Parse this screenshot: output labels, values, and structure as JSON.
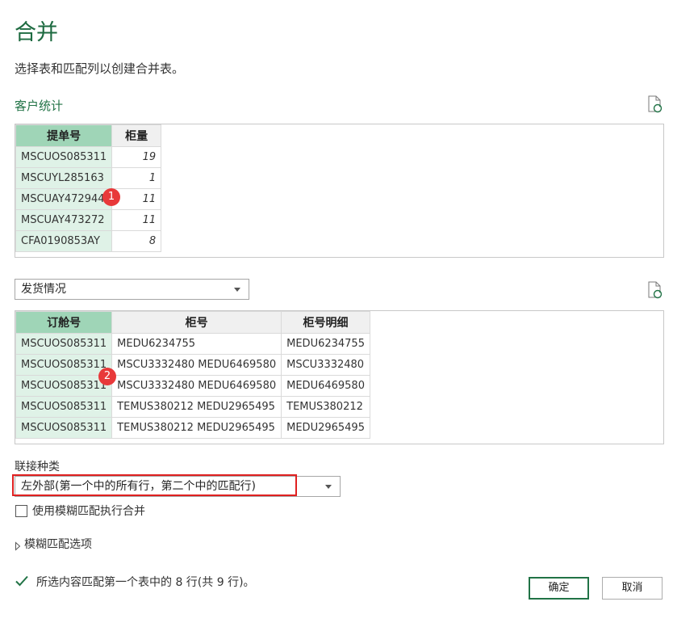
{
  "dialog": {
    "title": "合并",
    "description": "选择表和匹配列以创建合并表。"
  },
  "table1": {
    "name": "客户统计",
    "columns": [
      "提单号",
      "柜量"
    ],
    "rows": [
      [
        "MSCUOS085311",
        "19"
      ],
      [
        "MSCUYL285163",
        "1"
      ],
      [
        "MSCUAY472944",
        "11"
      ],
      [
        "MSCUAY473272",
        "11"
      ],
      [
        "CFA0190853AY",
        "8"
      ]
    ]
  },
  "table2": {
    "selected": "发货情况",
    "columns": [
      "订舱号",
      "柜号",
      "柜号明细"
    ],
    "rows": [
      [
        "MSCUOS085311",
        "MEDU6234755",
        "MEDU6234755"
      ],
      [
        "MSCUOS085311",
        "MSCU3332480 MEDU6469580",
        "MSCU3332480"
      ],
      [
        "MSCUOS085311",
        "MSCU3332480 MEDU6469580",
        "MEDU6469580"
      ],
      [
        "MSCUOS085311",
        "TEMUS380212 MEDU2965495",
        "TEMUS380212"
      ],
      [
        "MSCUOS085311",
        "TEMUS380212 MEDU2965495",
        "MEDU2965495"
      ]
    ]
  },
  "markers": [
    "1",
    "2"
  ],
  "join": {
    "label": "联接种类",
    "selected": "左外部(第一个中的所有行，第二个中的匹配行)"
  },
  "fuzzy": {
    "checkbox_label": "使用模糊匹配执行合并",
    "options_label": "模糊匹配选项"
  },
  "status": "所选内容匹配第一个表中的 8 行(共 9 行)。",
  "buttons": {
    "ok": "确定",
    "cancel": "取消"
  },
  "colors": {
    "accent": "#217346",
    "highlight_red": "#e02020",
    "marker_red": "#e8393a"
  },
  "icons": [
    "refresh-preview-icon",
    "dropdown-arrow-icon",
    "expand-triangle-icon",
    "checkmark-icon"
  ]
}
